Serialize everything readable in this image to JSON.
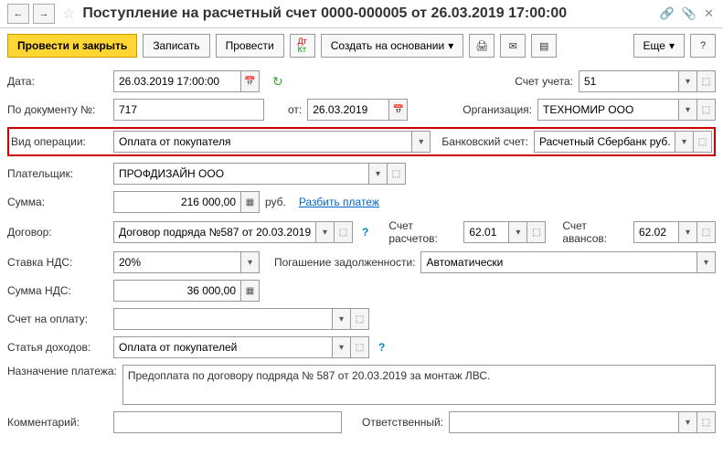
{
  "header": {
    "title": "Поступление на расчетный счет 0000-000005 от 26.03.2019 17:00:00"
  },
  "actions": {
    "post_close": "Провести и закрыть",
    "save": "Записать",
    "post": "Провести",
    "create_based": "Создать на основании",
    "more": "Еще"
  },
  "labels": {
    "date": "Дата:",
    "doc_num": "По документу №:",
    "from": "от:",
    "op_type": "Вид операции:",
    "payer": "Плательщик:",
    "amount": "Сумма:",
    "currency": "руб.",
    "split": "Разбить платеж",
    "contract": "Договор:",
    "vat_rate": "Ставка НДС:",
    "vat_amount": "Сумма НДС:",
    "invoice": "Счет на оплату:",
    "income_item": "Статья доходов:",
    "purpose": "Назначение платежа:",
    "comment": "Комментарий:",
    "account": "Счет учета:",
    "org": "Организация:",
    "bank_acct": "Банковский счет:",
    "settle_acct": "Счет расчетов:",
    "advance_acct": "Счет авансов:",
    "debt_repay": "Погашение задолженности:",
    "responsible": "Ответственный:"
  },
  "values": {
    "date": "26.03.2019 17:00:00",
    "doc_num": "717",
    "from_date": "26.03.2019",
    "op_type": "Оплата от покупателя",
    "payer": "ПРОФДИЗАЙН ООО",
    "amount": "216 000,00",
    "contract": "Договор подряда №587 от 20.03.2019",
    "vat_rate": "20%",
    "vat_amount": "36 000,00",
    "income_item": "Оплата от покупателей",
    "purpose": "Предоплата по договору подряда № 587 от 20.03.2019 за монтаж ЛВС.",
    "account": "51",
    "org": "ТЕХНОМИР ООО",
    "bank_acct": "Расчетный Сбербанк руб.",
    "settle_acct": "62.01",
    "advance_acct": "62.02",
    "debt_repay": "Автоматически"
  }
}
